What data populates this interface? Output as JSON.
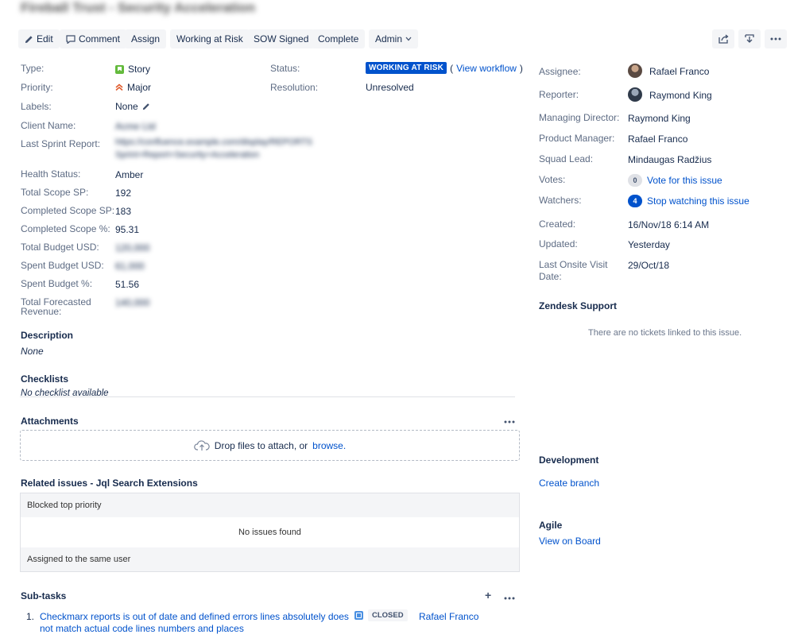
{
  "issue": {
    "title": "Fireball Trust - Security Acceleration"
  },
  "toolbar": {
    "edit": "Edit",
    "comment": "Comment",
    "assign": "Assign",
    "working_at_risk": "Working at Risk",
    "sow_signed": "SOW Signed",
    "complete": "Complete",
    "admin": "Admin"
  },
  "details": {
    "type_label": "Type:",
    "type_value": "Story",
    "priority_label": "Priority:",
    "priority_value": "Major",
    "labels_label": "Labels:",
    "labels_value": "None",
    "client_name_label": "Client Name:",
    "client_name_value": "Acme Ltd",
    "last_sprint_label": "Last Sprint Report:",
    "last_sprint_value_1": "https://confluence.example.com/display/REPORTS",
    "last_sprint_value_2": "Sprint+Report+Security+Acceleration",
    "health_label": "Health Status:",
    "health_value": "Amber",
    "total_scope_label": "Total Scope SP:",
    "total_scope_value": "192",
    "completed_scope_label": "Completed Scope SP:",
    "completed_scope_value": "183",
    "completed_pct_label": "Completed Scope %:",
    "completed_pct_value": "95.31",
    "total_budget_label": "Total Budget USD:",
    "total_budget_value": "120,000",
    "spent_budget_label": "Spent Budget USD:",
    "spent_budget_value": "61,000",
    "spent_pct_label": "Spent Budget %:",
    "spent_pct_value": "51.56",
    "forecast_label_1": "Total Forecasted",
    "forecast_label_2": "Revenue:",
    "forecast_value": "140,000",
    "status_label": "Status:",
    "status_value": "WORKING AT RISK",
    "view_workflow": "View workflow",
    "resolution_label": "Resolution:",
    "resolution_value": "Unresolved"
  },
  "description": {
    "heading": "Description",
    "value": "None"
  },
  "checklists": {
    "heading": "Checklists",
    "value": "No checklist available"
  },
  "attachments": {
    "heading": "Attachments",
    "drop_text": "Drop files to attach, or",
    "browse": "browse."
  },
  "related": {
    "heading": "Related issues - Jql Search Extensions",
    "blocked": "Blocked top priority",
    "no_issues": "No issues found",
    "assigned_same": "Assigned to the same user"
  },
  "subtasks": {
    "heading": "Sub-tasks",
    "items": [
      {
        "number": "1.",
        "summary_1": "Checkmarx reports is out of date and defined errors lines absolutely does",
        "summary_2": "not match actual code lines numbers and places",
        "status": "CLOSED",
        "assignee": "Rafael Franco"
      }
    ]
  },
  "people": {
    "assignee_label": "Assignee:",
    "assignee_value": "Rafael Franco",
    "reporter_label": "Reporter:",
    "reporter_value": "Raymond King",
    "director_label": "Managing Director:",
    "director_value": "Raymond King",
    "pm_label": "Product Manager:",
    "pm_value": "Rafael Franco",
    "squad_label": "Squad Lead:",
    "squad_value": "Mindaugas Radžius",
    "votes_label": "Votes:",
    "votes_count": "0",
    "votes_link": "Vote for this issue",
    "watchers_label": "Watchers:",
    "watchers_count": "4",
    "watchers_link": "Stop watching this issue"
  },
  "dates": {
    "created_label": "Created:",
    "created_value": "16/Nov/18 6:14 AM",
    "updated_label": "Updated:",
    "updated_value": "Yesterday",
    "onsite_label_1": "Last Onsite Visit",
    "onsite_label_2": "Date:",
    "onsite_value": "29/Oct/18"
  },
  "zendesk": {
    "heading": "Zendesk Support",
    "empty": "There are no tickets linked to this issue."
  },
  "development": {
    "heading": "Development",
    "create_branch": "Create branch"
  },
  "agile": {
    "heading": "Agile",
    "view_board": "View on Board"
  },
  "colors": {
    "accent": "#0052cc",
    "text": "#172b4d",
    "muted": "#5e6c84",
    "button_bg": "#f4f5f7"
  }
}
